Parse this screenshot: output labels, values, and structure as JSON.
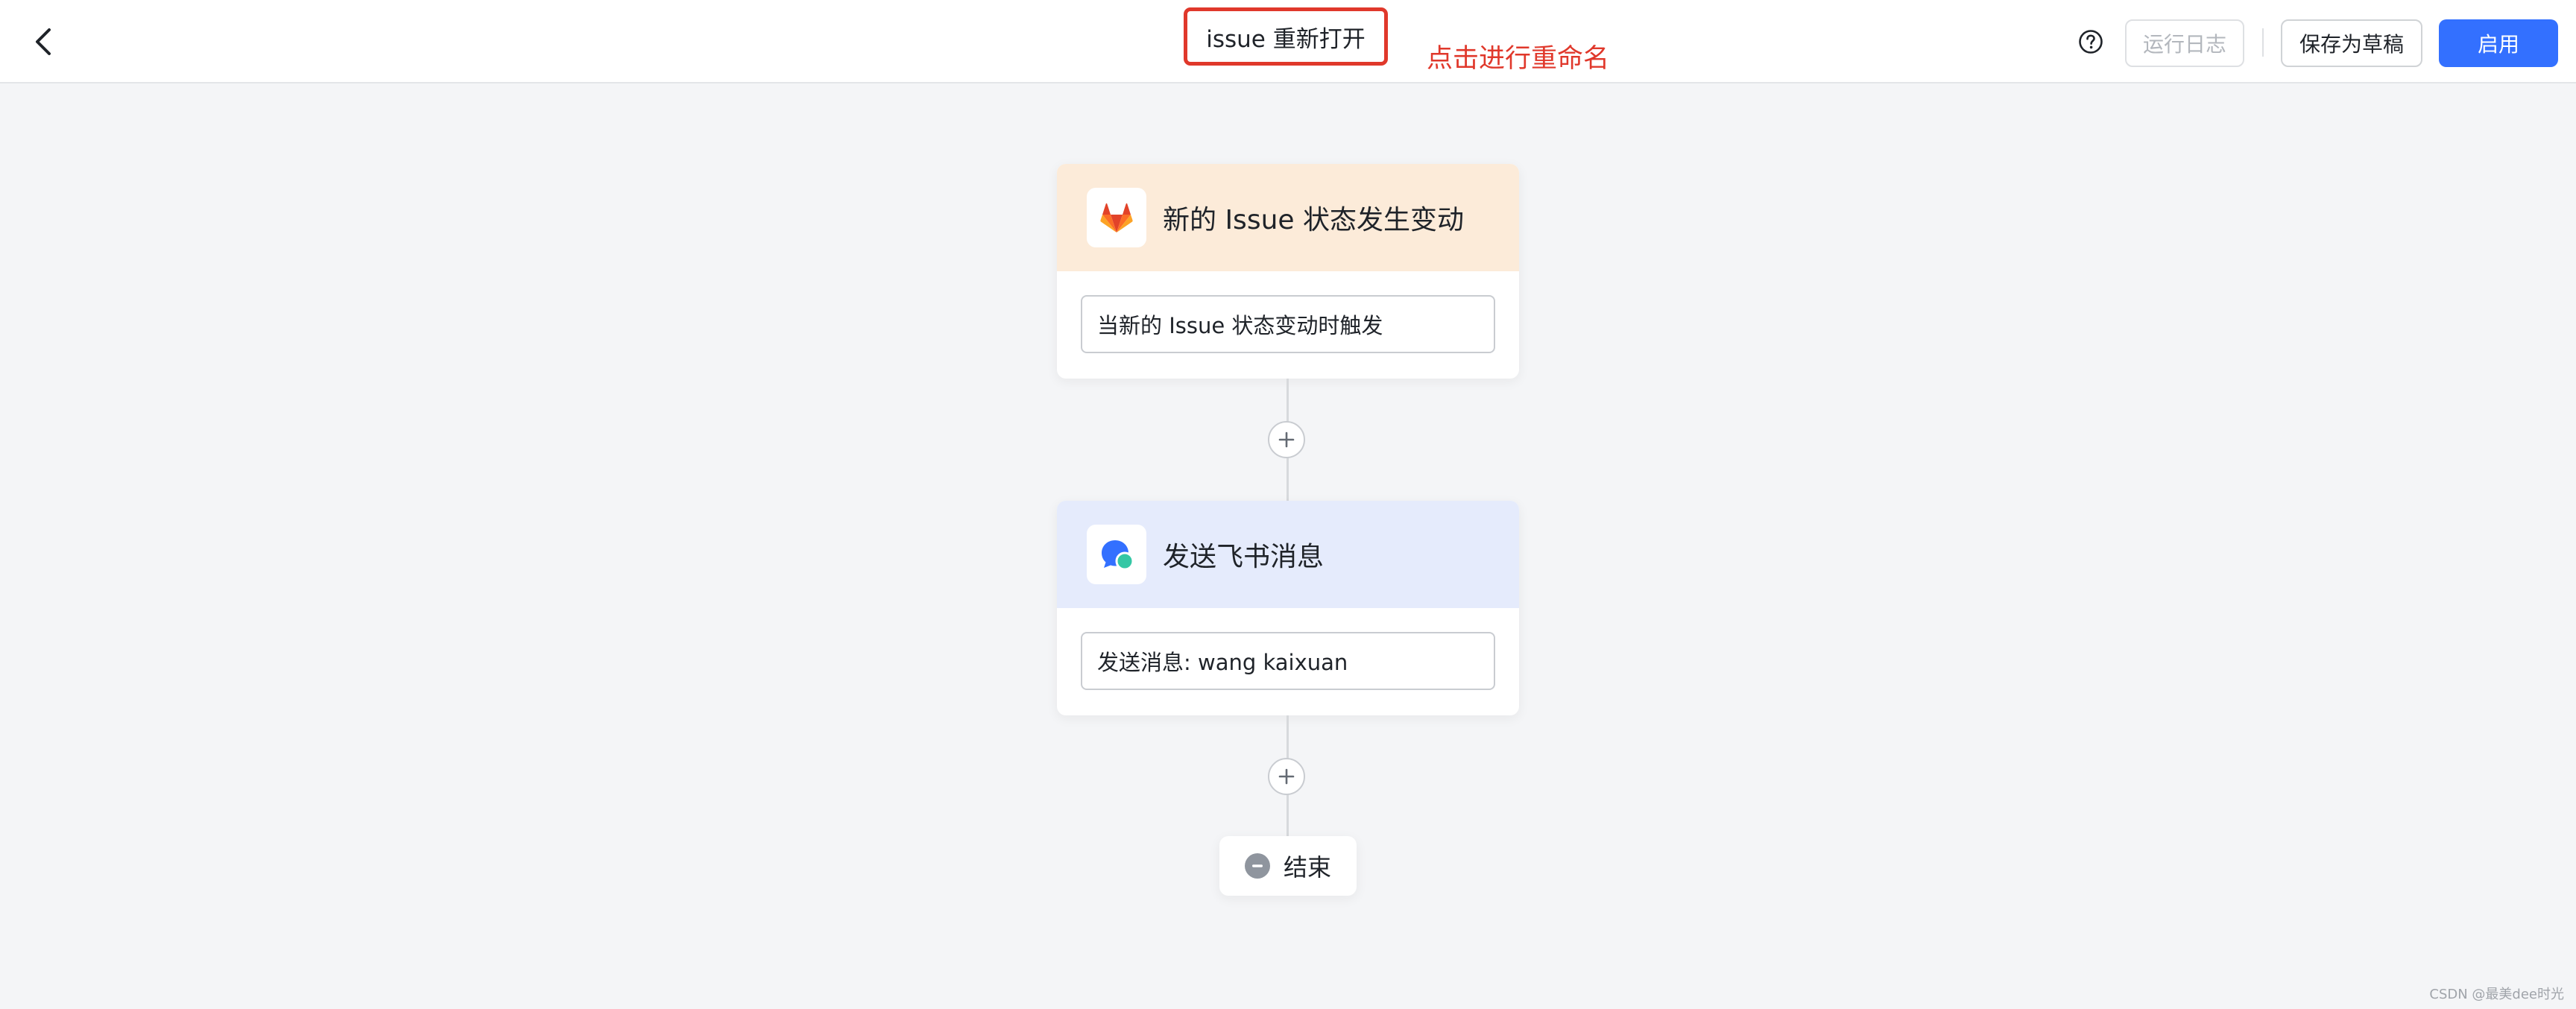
{
  "header": {
    "title": "issue 重新打开",
    "rename_hint": "点击进行重命名",
    "buttons": {
      "run_log": "运行日志",
      "save_draft": "保存为草稿",
      "enable": "启用"
    }
  },
  "flow": {
    "trigger": {
      "icon": "gitlab-icon",
      "title": "新的 Issue 状态发生变动",
      "description": "当新的 Issue 状态变动时触发"
    },
    "action": {
      "icon": "feishu-message-icon",
      "title": "发送飞书消息",
      "description": "发送消息: wang kaixuan"
    },
    "end": {
      "label": "结束"
    }
  },
  "watermark": "CSDN @最美dee时光",
  "colors": {
    "accent": "#3370ff",
    "highlight": "#e0382b",
    "trigger_header": "#fcebd9",
    "action_header": "#e5ebfc"
  }
}
